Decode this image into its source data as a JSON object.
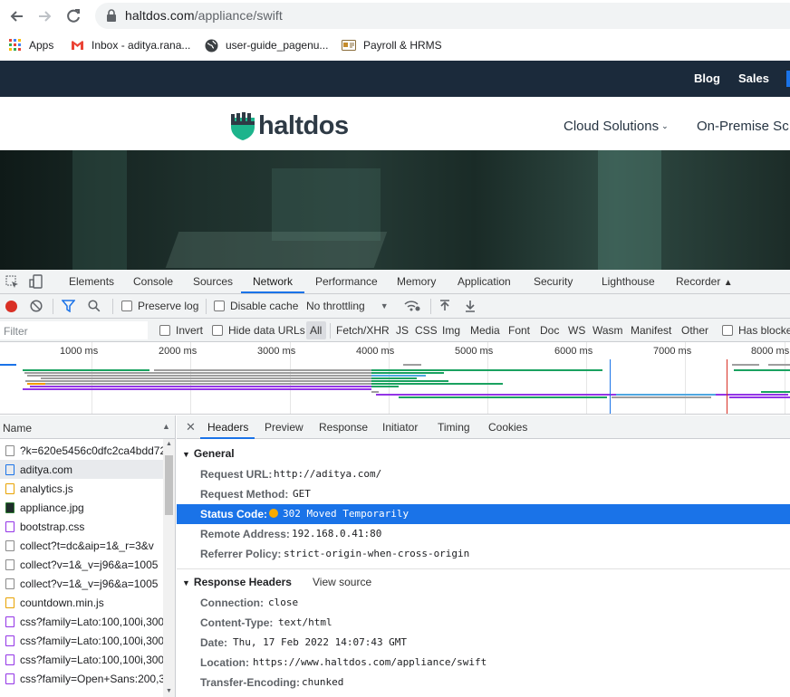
{
  "browser": {
    "url_host": "haltdos.com",
    "url_path": "/appliance/swift",
    "bookmarks": [
      {
        "icon": "apps-grid-icon",
        "label": "Apps"
      },
      {
        "icon": "gmail-icon",
        "label": "Inbox - aditya.rana..."
      },
      {
        "icon": "globe-icon",
        "label": "user-guide_pagenu..."
      },
      {
        "icon": "payroll-icon",
        "label": "Payroll & HRMS"
      }
    ]
  },
  "site": {
    "top_links": [
      "Blog",
      "Sales"
    ],
    "logo_text": "haltdos",
    "nav": [
      "Cloud Solutions",
      "On-Premise Sc"
    ],
    "colors": {
      "topbar": "#1b2a3b",
      "logo": "#2e3a45",
      "logo_mark": "#1db48c"
    }
  },
  "devtools": {
    "tabs": [
      "Elements",
      "Console",
      "Sources",
      "Network",
      "Performance",
      "Memory",
      "Application",
      "Security",
      "Lighthouse",
      "Recorder"
    ],
    "active_tab": "Network",
    "toolbar": {
      "preserve_log": "Preserve log",
      "disable_cache": "Disable cache",
      "throttling": "No throttling"
    },
    "filter": {
      "placeholder": "Filter",
      "invert": "Invert",
      "hide_data_urls": "Hide data URLs",
      "types": [
        "All",
        "Fetch/XHR",
        "JS",
        "CSS",
        "Img",
        "Media",
        "Font",
        "Doc",
        "WS",
        "Wasm",
        "Manifest",
        "Other"
      ],
      "has_blocked": "Has blocke"
    },
    "timeline": {
      "ticks": [
        "1000 ms",
        "2000 ms",
        "3000 ms",
        "4000 ms",
        "5000 ms",
        "6000 ms",
        "7000 ms",
        "8000 ms"
      ]
    },
    "requests": {
      "header": "Name",
      "rows": [
        {
          "name": "?k=620e5456c0dfc2ca4bdd72",
          "type": "other",
          "selected": false
        },
        {
          "name": "aditya.com",
          "type": "doc",
          "selected": true
        },
        {
          "name": "analytics.js",
          "type": "script",
          "selected": false
        },
        {
          "name": "appliance.jpg",
          "type": "img",
          "selected": false
        },
        {
          "name": "bootstrap.css",
          "type": "css",
          "selected": false
        },
        {
          "name": "collect?t=dc&aip=1&_r=3&v",
          "type": "other",
          "selected": false
        },
        {
          "name": "collect?v=1&_v=j96&a=1005",
          "type": "other",
          "selected": false
        },
        {
          "name": "collect?v=1&_v=j96&a=1005",
          "type": "other",
          "selected": false
        },
        {
          "name": "countdown.min.js",
          "type": "script",
          "selected": false
        },
        {
          "name": "css?family=Lato:100,100i,300,",
          "type": "css",
          "selected": false
        },
        {
          "name": "css?family=Lato:100,100i,300,",
          "type": "css",
          "selected": false
        },
        {
          "name": "css?family=Lato:100,100i,300,",
          "type": "css",
          "selected": false
        },
        {
          "name": "css?family=Open+Sans:200,3",
          "type": "css",
          "selected": false
        }
      ]
    },
    "details": {
      "tabs": [
        "Headers",
        "Preview",
        "Response",
        "Initiator",
        "Timing",
        "Cookies"
      ],
      "active_tab": "Headers",
      "general_title": "General",
      "general": [
        {
          "key": "Request URL:",
          "value": "http://aditya.com/"
        },
        {
          "key": "Request Method:",
          "value": "GET"
        },
        {
          "key": "Status Code:",
          "value": "302 Moved Temporarily"
        },
        {
          "key": "Remote Address:",
          "value": "192.168.0.41:80"
        },
        {
          "key": "Referrer Policy:",
          "value": "strict-origin-when-cross-origin"
        }
      ],
      "response_title": "Response Headers",
      "view_source": "View source",
      "response": [
        {
          "key": "Connection:",
          "value": "close"
        },
        {
          "key": "Content-Type:",
          "value": "text/html"
        },
        {
          "key": "Date:",
          "value": "Thu, 17 Feb 2022 14:07:43 GMT"
        },
        {
          "key": "Location:",
          "value": "https://www.haltdos.com/appliance/swift"
        },
        {
          "key": "Transfer-Encoding:",
          "value": "chunked"
        }
      ]
    }
  }
}
